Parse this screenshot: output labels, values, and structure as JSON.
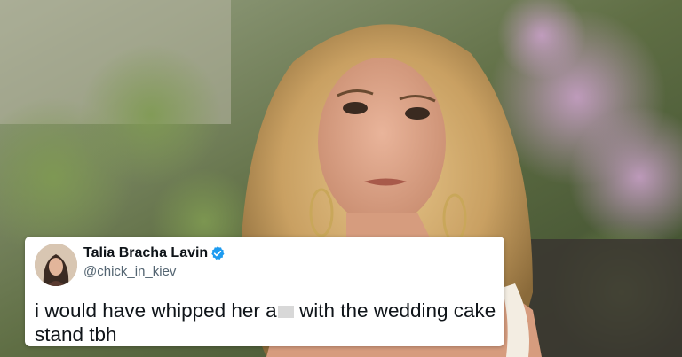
{
  "tweet": {
    "display_name": "Talia Bracha Lavin",
    "handle": "@chick_in_kiev",
    "verified": true,
    "text_before_censor": "i would have whipped her a",
    "text_after_censor": " with the wedding cake stand tbh"
  },
  "colors": {
    "verified_badge": "#1d9bf0",
    "name_text": "#0f1419",
    "handle_text": "#536471",
    "card_background": "#ffffff"
  },
  "icons": {
    "verified": "verified-badge-icon"
  }
}
